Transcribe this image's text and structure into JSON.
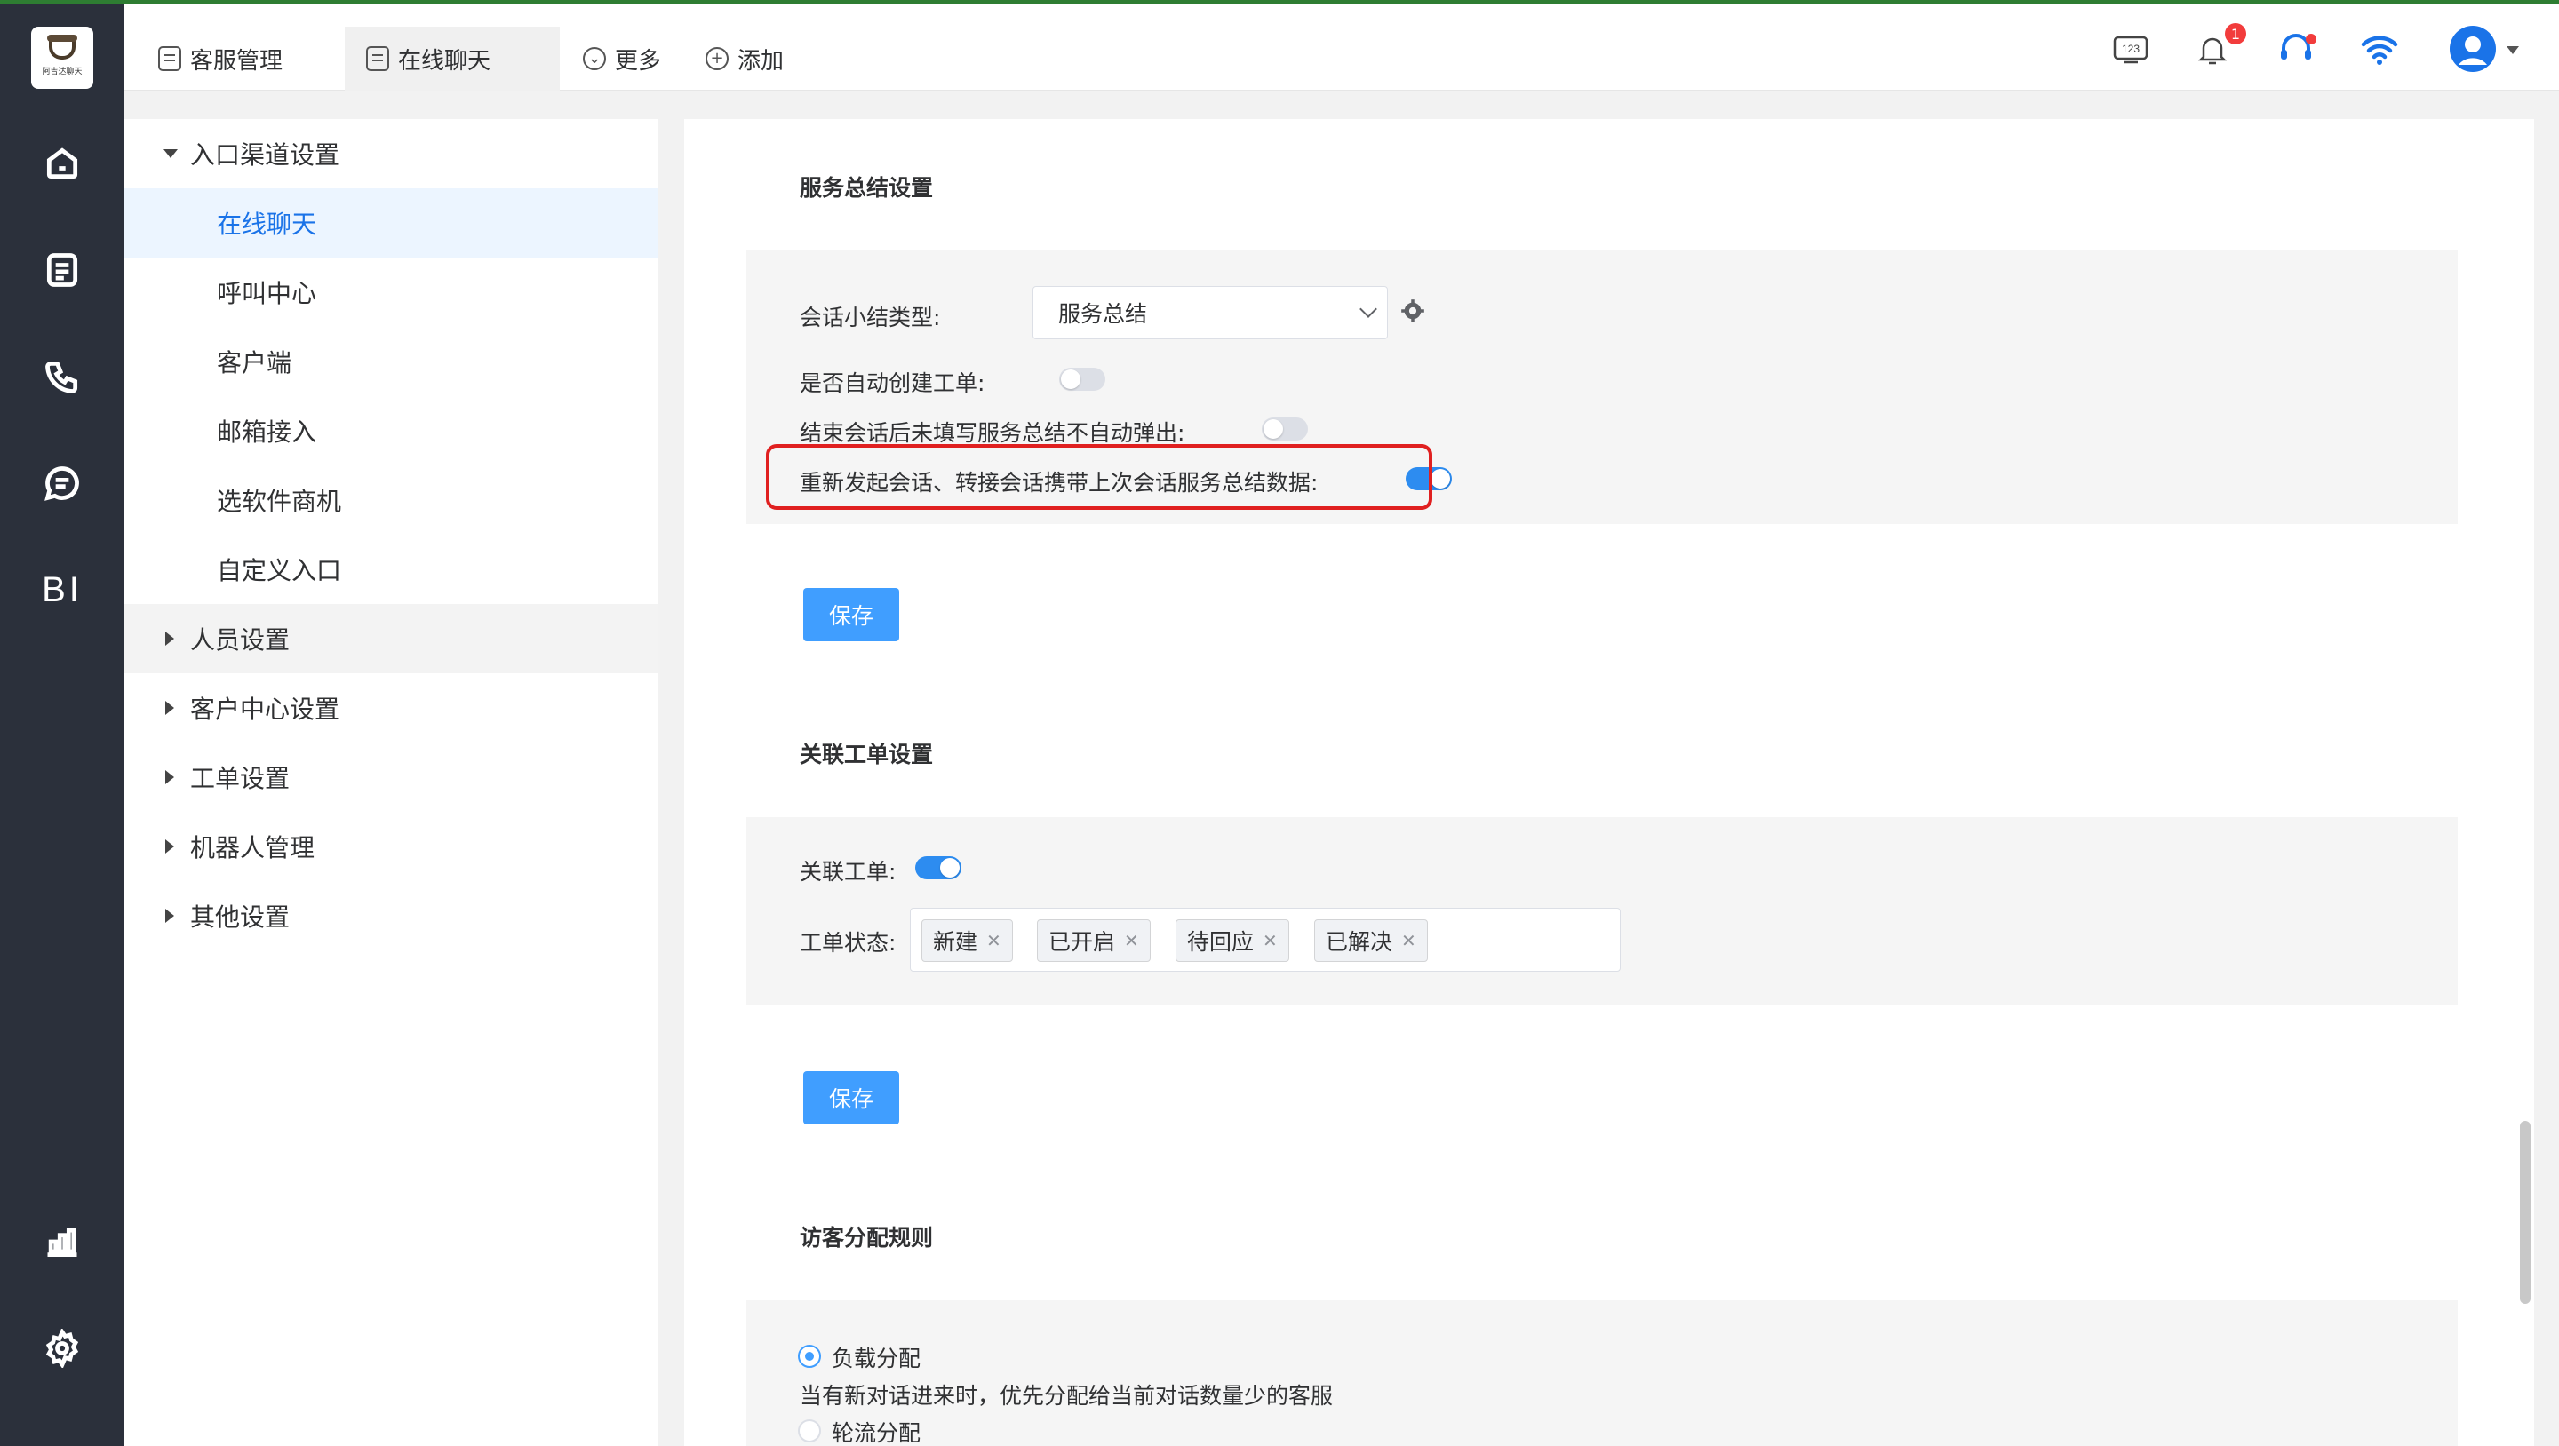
{
  "app": {
    "logo_text": "阿吉达聊天"
  },
  "top_tabs": [
    {
      "label": "客服管理",
      "icon": "doc-icon"
    },
    {
      "label": "在线聊天",
      "icon": "doc-icon",
      "active": true
    },
    {
      "label": "更多",
      "icon": "chevron-circle-icon"
    },
    {
      "label": "添加",
      "icon": "plus-circle-icon"
    }
  ],
  "top_right": {
    "keypad_label": "123",
    "notification_count": "1"
  },
  "rail": {
    "bi_label": "BI"
  },
  "tree": {
    "root": "入口渠道设置",
    "children": [
      "在线聊天",
      "呼叫中心",
      "客户端",
      "邮箱接入",
      "选软件商机",
      "自定义入口"
    ],
    "sections": [
      "人员设置",
      "客户中心设置",
      "工单设置",
      "机器人管理",
      "其他设置"
    ]
  },
  "service_summary": {
    "title": "服务总结设置",
    "type_label": "会话小结类型:",
    "type_value": "服务总结",
    "auto_ticket_label": "是否自动创建工单:",
    "auto_ticket_on": false,
    "no_popup_label": "结束会话后未填写服务总结不自动弹出:",
    "no_popup_on": false,
    "carry_label": "重新发起会话、转接会话携带上次会话服务总结数据:",
    "carry_on": true,
    "save_label": "保存"
  },
  "linked_ticket": {
    "title": "关联工单设置",
    "link_label": "关联工单:",
    "link_on": true,
    "status_label": "工单状态:",
    "statuses": [
      "新建",
      "已开启",
      "待回应",
      "已解决"
    ],
    "save_label": "保存"
  },
  "visitor_rule": {
    "title": "访客分配规则",
    "option1_label": "负载分配",
    "option1_desc": "当有新对话进来时，优先分配给当前对话数量少的客服",
    "option2_label": "轮流分配"
  },
  "colors": {
    "rail_bg": "#2b303b",
    "accent": "#409eff",
    "highlight": "#e02020"
  }
}
